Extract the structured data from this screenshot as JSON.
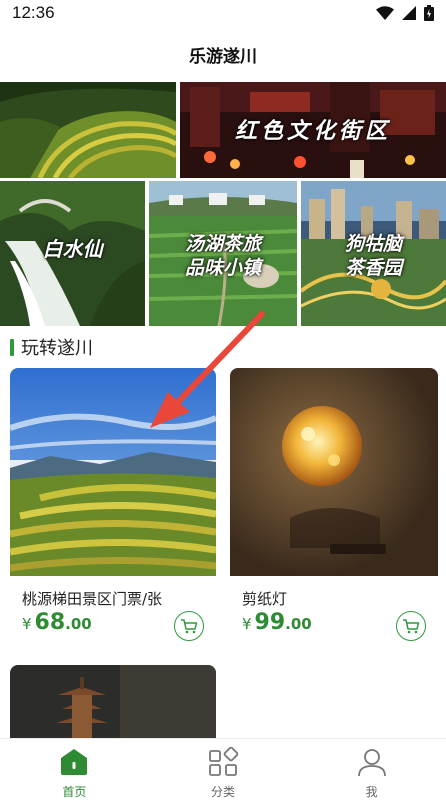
{
  "status_bar": {
    "time": "12:36"
  },
  "header": {
    "title": "乐游遂川"
  },
  "banners": [
    {
      "label": ""
    },
    {
      "label": "红色文化街区"
    },
    {
      "label": "白水仙"
    },
    {
      "label": "汤湖茶旅\n品味小镇"
    },
    {
      "label": "狗牯脑\n茶香园"
    }
  ],
  "section": {
    "title": "玩转遂川"
  },
  "products": [
    {
      "name": "桃源梯田景区门票/张",
      "currency": "¥",
      "price_int": "68",
      "price_dec": ".00"
    },
    {
      "name": "剪纸灯",
      "currency": "¥",
      "price_int": "99",
      "price_dec": ".00"
    }
  ],
  "nav": [
    {
      "label": "首页",
      "icon": "home-icon",
      "active": true
    },
    {
      "label": "分类",
      "icon": "category-icon",
      "active": false
    },
    {
      "label": "我",
      "icon": "profile-icon",
      "active": false
    }
  ],
  "colors": {
    "accent": "#2e8b34",
    "annotation_arrow": "#e8473a"
  }
}
